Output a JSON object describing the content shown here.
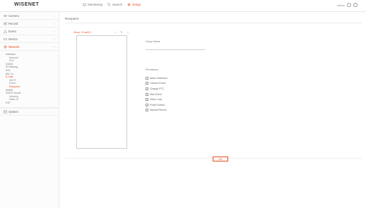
{
  "brand": {
    "logo": "WISENET",
    "accent": "#e74c1c"
  },
  "topnav": {
    "items": [
      {
        "label": "Monitoring",
        "icon": "monitor-icon",
        "active": false
      },
      {
        "label": "Search",
        "icon": "search-icon",
        "active": false
      },
      {
        "label": "Setup",
        "icon": "gear-icon",
        "active": true
      }
    ]
  },
  "topright": {
    "user": "admin",
    "icons": [
      "logout-icon",
      "help-icon"
    ]
  },
  "sidebar": {
    "sections": [
      {
        "label": "Camera",
        "icon": "camera-icon",
        "active": false
      },
      {
        "label": "Record",
        "icon": "record-icon",
        "active": false
      },
      {
        "label": "Event",
        "icon": "event-icon",
        "active": false
      },
      {
        "label": "Device",
        "icon": "device-icon",
        "active": false
      },
      {
        "label": "Network",
        "icon": "network-icon",
        "active": true
      }
    ],
    "network_sub": [
      {
        "label": "Interface",
        "level": 1,
        "active": false
      },
      {
        "label": "Network",
        "level": 2,
        "active": false
      },
      {
        "label": "Port",
        "level": 2,
        "active": false
      },
      {
        "label": "DDNS",
        "level": 1,
        "active": false
      },
      {
        "label": "IP Filtering",
        "level": 1,
        "active": false
      },
      {
        "label": "SSL",
        "level": 1,
        "active": false
      },
      {
        "label": "802.1x",
        "level": 1,
        "active": false
      },
      {
        "label": "E-mail",
        "level": 1,
        "active": true
      },
      {
        "label": "SMTP",
        "level": 2,
        "active": false
      },
      {
        "label": "Event",
        "level": 2,
        "active": false
      },
      {
        "label": "Recipient",
        "level": 2,
        "active": true
      },
      {
        "label": "SNMP",
        "level": 1,
        "active": false
      },
      {
        "label": "DHCP Server",
        "level": 1,
        "active": false
      },
      {
        "label": "Network",
        "level": 2,
        "active": false
      },
      {
        "label": "Static IP",
        "level": 2,
        "active": false
      },
      {
        "label": "P2P",
        "level": 1,
        "active": false
      }
    ],
    "system": {
      "label": "System",
      "icon": "system-icon"
    }
  },
  "main": {
    "title": "Recipient",
    "list_toolbar": {
      "group_select": "Group : E-mail 01",
      "add": "+",
      "edit": "✎",
      "delete": "×"
    },
    "form": {
      "group_name_label": "Group Name",
      "group_name_value": "",
      "permissions_label": "Permission",
      "permissions": [
        "Alarm Detection",
        "Camera Event",
        "Change PTZ",
        "Disk Event",
        "Video Loss",
        "Power Switch",
        "Manual Record"
      ]
    },
    "ok_label": "OK"
  }
}
